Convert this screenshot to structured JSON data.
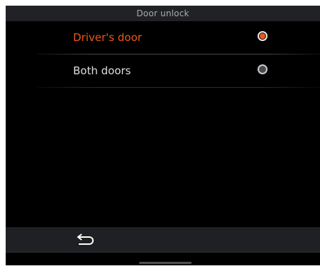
{
  "header": {
    "title": "Door unlock"
  },
  "options": [
    {
      "label": "Driver's door",
      "selected": true
    },
    {
      "label": "Both doors",
      "selected": false
    }
  ],
  "footer": {
    "back_icon": "back-arrow-icon"
  },
  "colors": {
    "accent": "#e8581f",
    "background": "#000000",
    "bar": "#202225",
    "text": "#dedfe1"
  }
}
